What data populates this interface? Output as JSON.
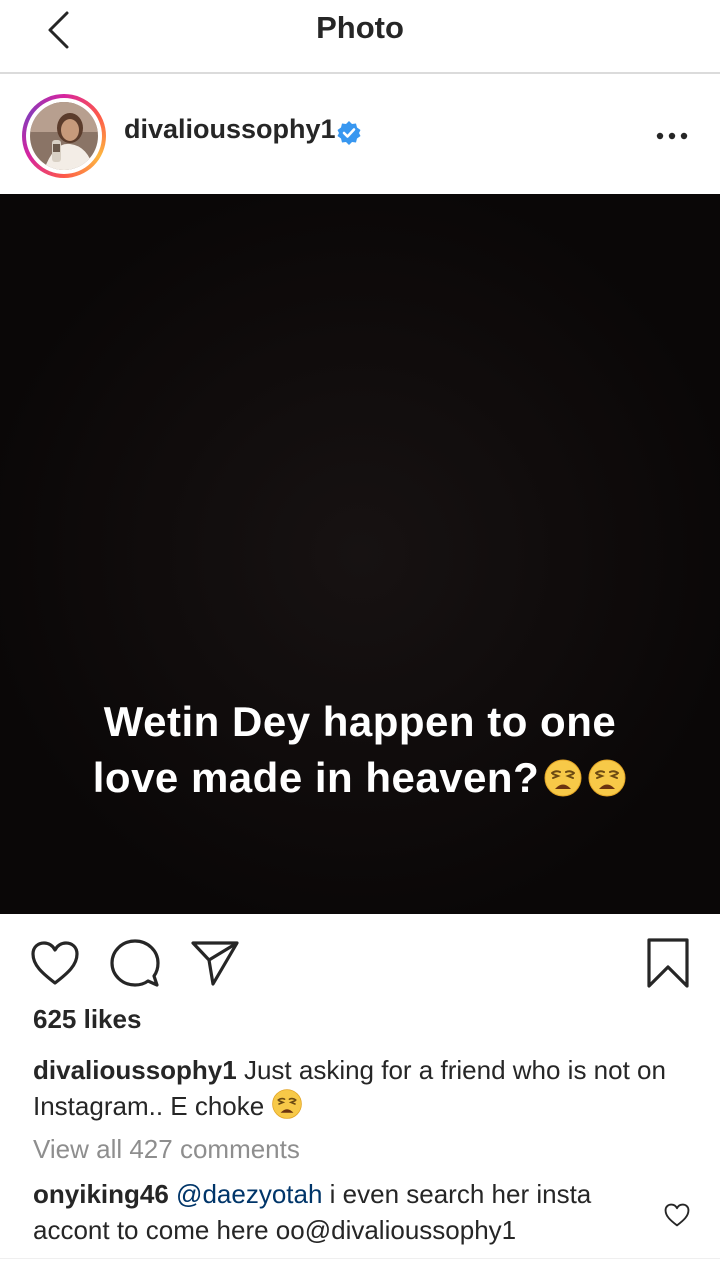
{
  "header": {
    "title": "Photo",
    "back_icon": "chevron-left-icon"
  },
  "post": {
    "username": "divalioussophy1",
    "verified_icon": "verified-badge-icon",
    "more_icon": "ellipsis-icon",
    "image_text_line1": "Wetin Dey happen to one",
    "image_text_line2": "love made in heaven?",
    "image_emoji": "weary-face-emoji",
    "likes": "625 likes",
    "caption_username": "divalioussophy1",
    "caption_text": " Just asking for a friend who is not on Instagram.. E choke ",
    "view_all": "View all 427 comments"
  },
  "comment": {
    "username": "onyiking46",
    "mention": " @daezyotah",
    "text": " i even search her insta accont to come here oo@divalioussophy1"
  },
  "colors": {
    "accent_blue": "#3897f0",
    "mention_blue": "#003569",
    "secondary_text": "#8e8e8e",
    "image_background": "#0b0808"
  }
}
